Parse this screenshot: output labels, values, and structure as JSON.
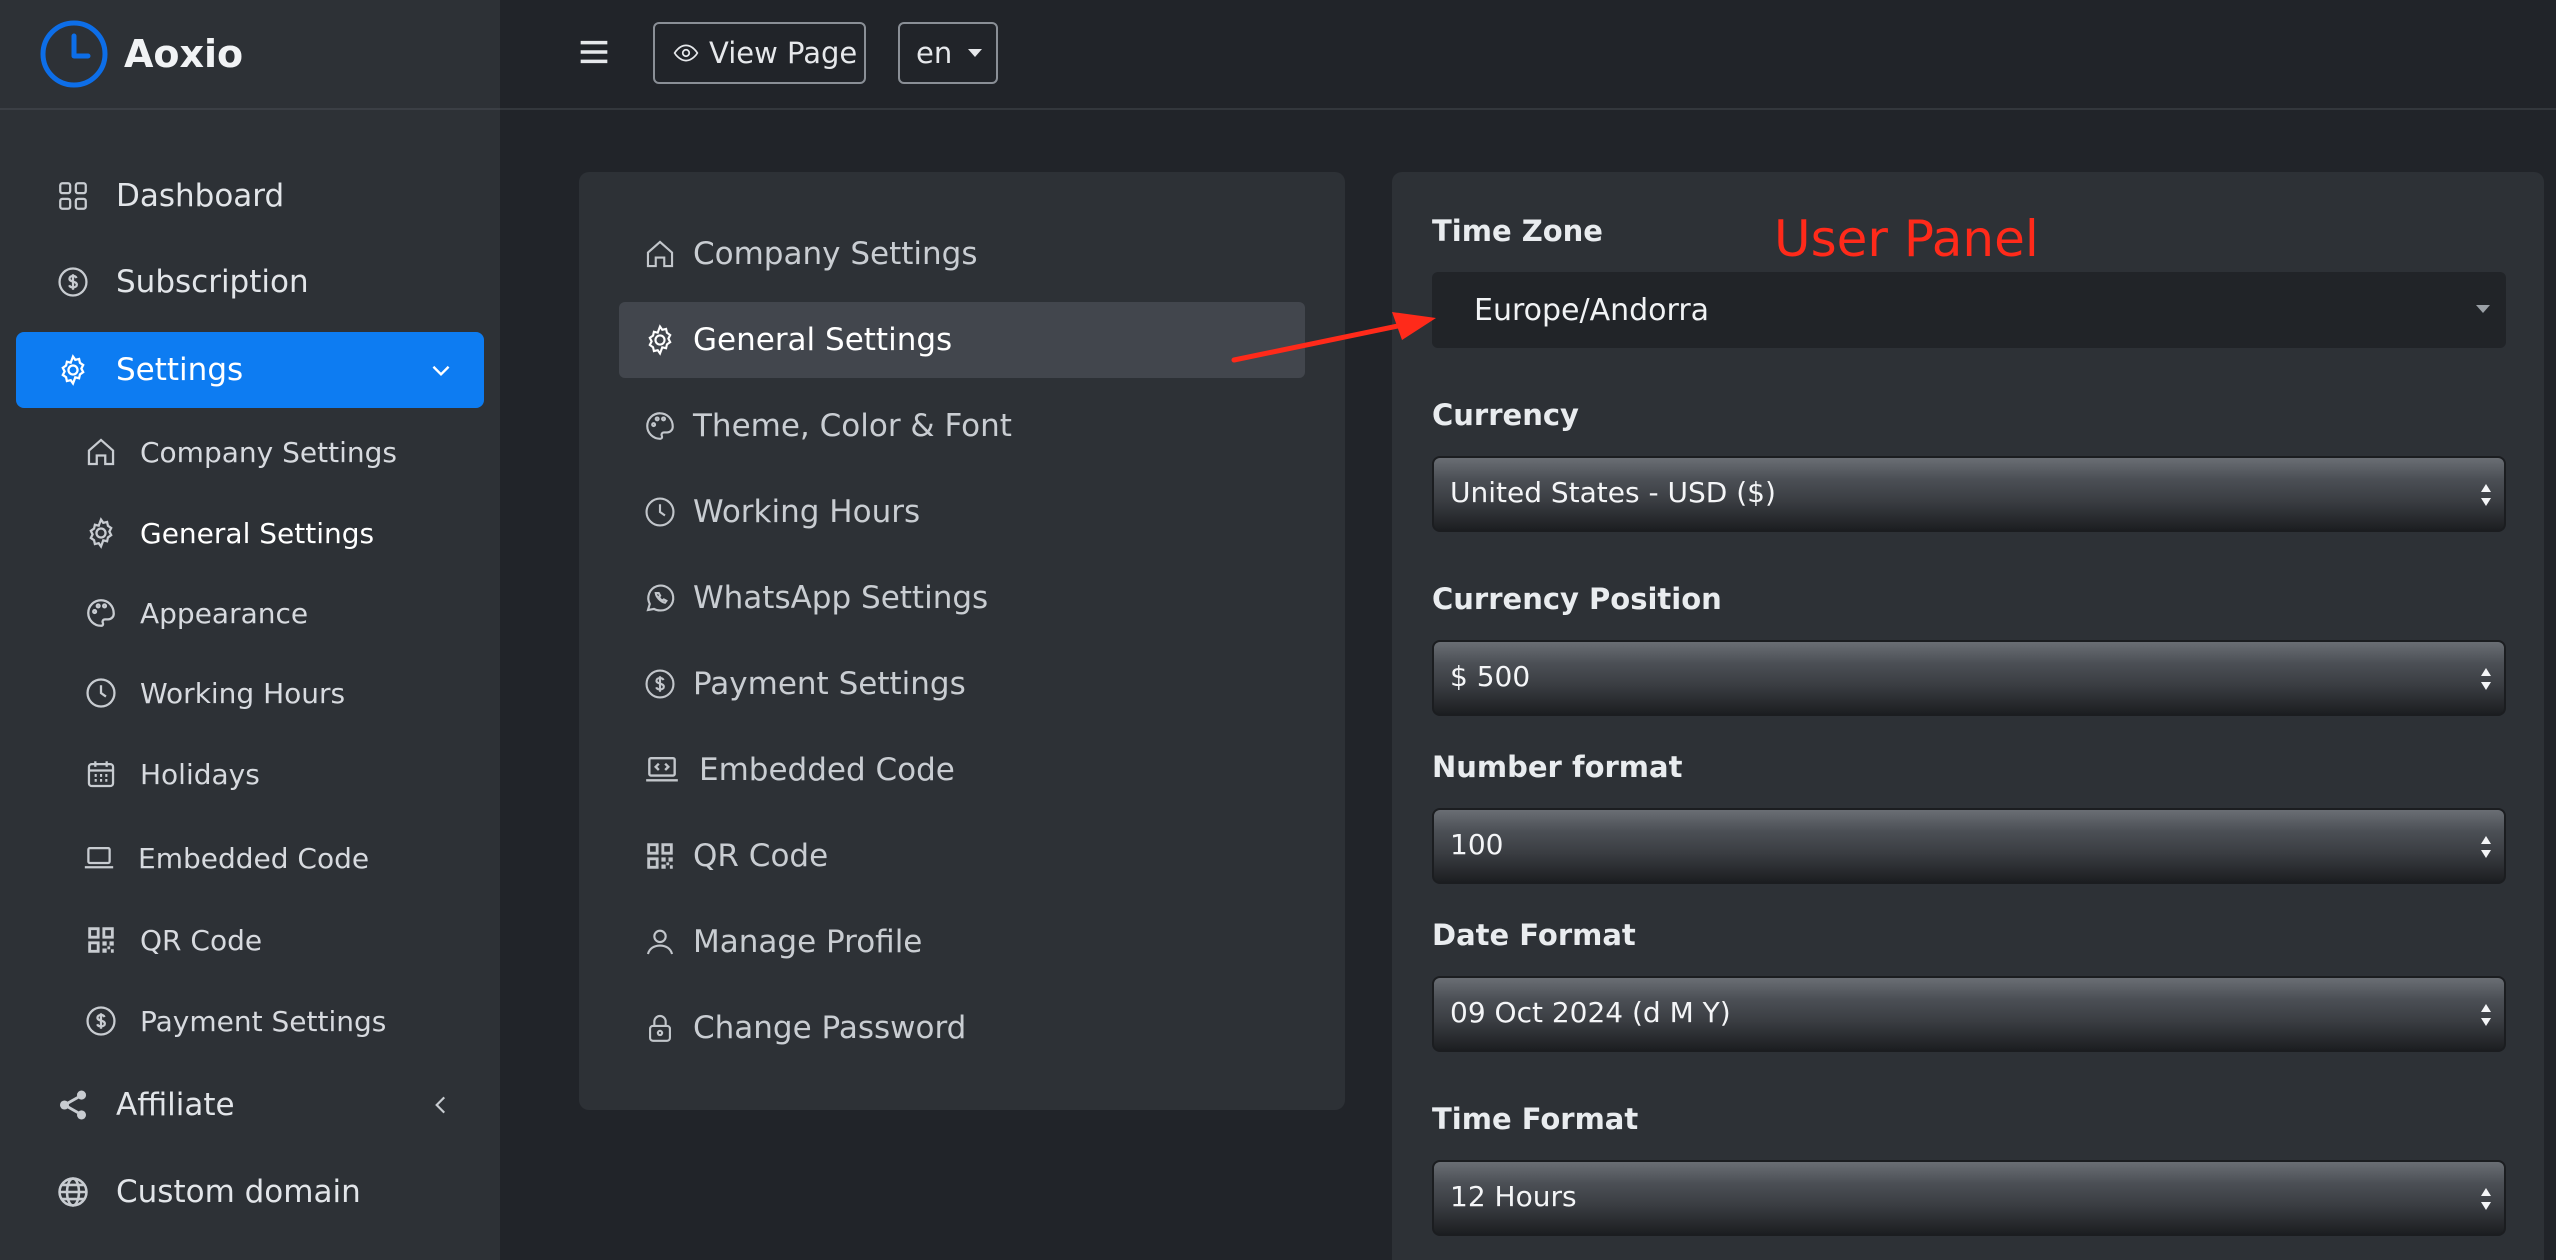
{
  "brand": {
    "name": "Aoxio",
    "accent": "#0d7cf2"
  },
  "topbar": {
    "view_page_label": "View Page",
    "language_label": "en"
  },
  "sidebar": {
    "items": [
      {
        "label": "Dashboard",
        "icon": "grid-icon"
      },
      {
        "label": "Subscription",
        "icon": "dollar-circle-icon"
      },
      {
        "label": "Settings",
        "icon": "gear-icon",
        "active": true
      },
      {
        "label": "Affiliate",
        "icon": "share-icon"
      },
      {
        "label": "Custom domain",
        "icon": "globe-icon"
      }
    ],
    "settings_sub": [
      {
        "label": "Company Settings",
        "icon": "home-icon"
      },
      {
        "label": "General Settings",
        "icon": "gear-icon",
        "current": true
      },
      {
        "label": "Appearance",
        "icon": "palette-icon"
      },
      {
        "label": "Working Hours",
        "icon": "clock-icon"
      },
      {
        "label": "Holidays",
        "icon": "calendar-icon"
      },
      {
        "label": "Embedded Code",
        "icon": "laptop-icon"
      },
      {
        "label": "QR Code",
        "icon": "qr-icon"
      },
      {
        "label": "Payment Settings",
        "icon": "dollar-circle-icon"
      }
    ]
  },
  "settings_menu": {
    "items": [
      {
        "label": "Company Settings",
        "icon": "home-icon"
      },
      {
        "label": "General Settings",
        "icon": "gear-icon",
        "active": true
      },
      {
        "label": "Theme, Color & Font",
        "icon": "palette-icon"
      },
      {
        "label": "Working Hours",
        "icon": "clock-icon"
      },
      {
        "label": "WhatsApp Settings",
        "icon": "whatsapp-icon"
      },
      {
        "label": "Payment Settings",
        "icon": "dollar-circle-icon"
      },
      {
        "label": "Embedded Code",
        "icon": "laptop-code-icon"
      },
      {
        "label": "QR Code",
        "icon": "qr-icon"
      },
      {
        "label": "Manage Profile",
        "icon": "user-icon"
      },
      {
        "label": "Change Password",
        "icon": "lock-icon"
      }
    ]
  },
  "form": {
    "time_zone": {
      "label": "Time Zone",
      "value": "Europe/Andorra"
    },
    "currency": {
      "label": "Currency",
      "value": "United States - USD ($)"
    },
    "currency_position": {
      "label": "Currency Position",
      "value": "$ 500"
    },
    "number_format": {
      "label": "Number format",
      "value": "100"
    },
    "date_format": {
      "label": "Date Format",
      "value": "09 Oct 2024 (d M Y)"
    },
    "time_format": {
      "label": "Time Format",
      "value": "12 Hours"
    }
  },
  "annotation": {
    "text": "User Panel",
    "color": "#ff2a1a"
  }
}
